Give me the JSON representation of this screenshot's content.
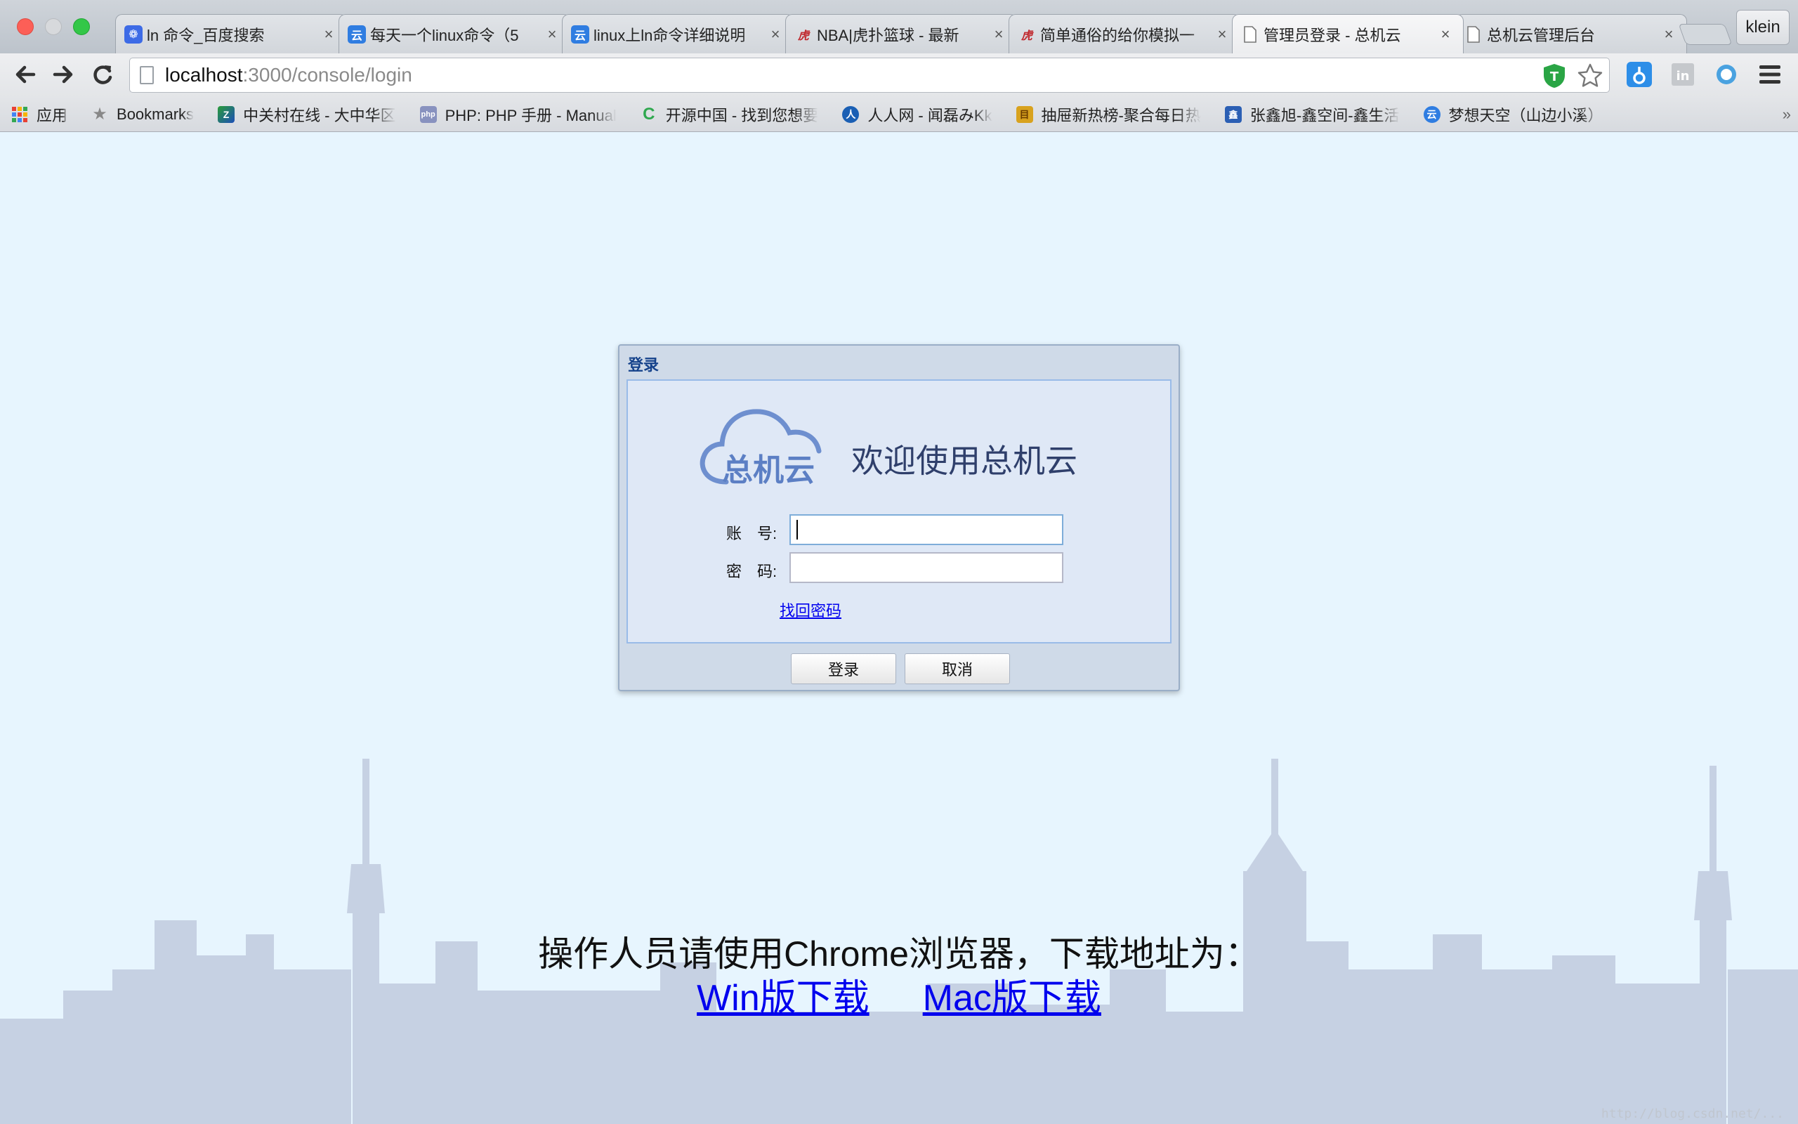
{
  "window": {
    "profile_name": "klein"
  },
  "tabs": [
    {
      "title": "ln 命令_百度搜索",
      "icon": "baidu-paw-icon",
      "color": "#3d6be6"
    },
    {
      "title": "每天一个linux命令（5",
      "icon": "blog-icon",
      "color": "#2f7de1"
    },
    {
      "title": "linux上ln命令详细说明",
      "icon": "blog-icon",
      "color": "#2f7de1"
    },
    {
      "title": "NBA|虎扑篮球 - 最新",
      "icon": "hupu-icon",
      "color": "#c0282d"
    },
    {
      "title": "简单通俗的给你模拟一",
      "icon": "hupu-icon",
      "color": "#c0282d"
    },
    {
      "title": "管理员登录 - 总机云",
      "icon": "page-icon",
      "color": "#888888",
      "active": true
    },
    {
      "title": "总机云管理后台",
      "icon": "page-icon",
      "color": "#888888"
    }
  ],
  "omnibox": {
    "host": "localhost",
    "path": ":3000/console/login"
  },
  "bookmarks": [
    {
      "label": "应用",
      "icon": "apps-grid-icon"
    },
    {
      "label": "Bookmarks",
      "icon": "star-folder-icon"
    },
    {
      "label": "中关村在线 - 大中华区",
      "icon": "zol-icon"
    },
    {
      "label": "PHP: PHP 手册 - Manual",
      "icon": "php-icon"
    },
    {
      "label": "开源中国 - 找到您想要",
      "icon": "oschina-icon"
    },
    {
      "label": "人人网 - 闻磊みKk",
      "icon": "renren-icon"
    },
    {
      "label": "抽屉新热榜-聚合每日热",
      "icon": "chouti-icon"
    },
    {
      "label": "张鑫旭-鑫空间-鑫生活",
      "icon": "zxx-icon"
    },
    {
      "label": "梦想天空（山边小溪）",
      "icon": "blog-icon"
    }
  ],
  "login": {
    "panel_title": "登录",
    "logo_text": "总机云",
    "welcome": "欢迎使用总机云",
    "account_label": "账　号:",
    "password_label": "密　码:",
    "account_value": "",
    "password_value": "",
    "recover_link": "找回密码",
    "login_button": "登录",
    "cancel_button": "取消"
  },
  "notice": {
    "text": "操作人员请使用Chrome浏览器，下载地址为：",
    "win_link": "Win版下载",
    "mac_link": "Mac版下载"
  },
  "watermark": "http://blog.csdn.net/..."
}
